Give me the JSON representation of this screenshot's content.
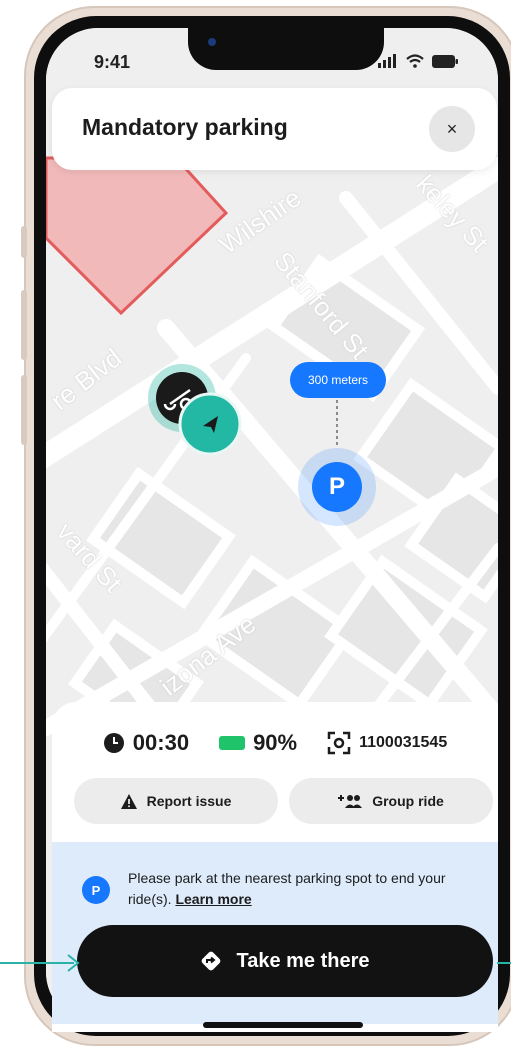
{
  "status_bar": {
    "time": "9:41"
  },
  "header": {
    "title": "Mandatory parking",
    "close_icon": "×"
  },
  "map": {
    "streets": [
      "Wilshire",
      "keley St",
      "Stanford St",
      "re Blvd",
      "vard St",
      "izona Ave"
    ],
    "distance_label": "300 meters",
    "parking_label": "P",
    "colors": {
      "restricted_fill": "#f1b9b9",
      "restricted_stroke": "#e35b5b",
      "accent": "#1677ff",
      "vehicle": "#22b8a3"
    }
  },
  "ride_stats": {
    "timer": "00:30",
    "battery": "90%",
    "vehicle_id": "1100031545"
  },
  "actions": {
    "report_issue": "Report issue",
    "group_ride": "Group ride"
  },
  "notice": {
    "icon_label": "P",
    "text": "Please park at the nearest parking spot to end your ride(s).",
    "link": "Learn more"
  },
  "cta": {
    "label": "Take me there"
  }
}
